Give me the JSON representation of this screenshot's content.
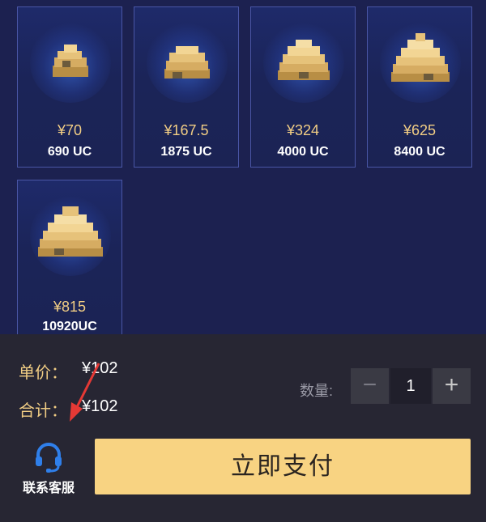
{
  "products": [
    {
      "price": "¥70",
      "amount": "690 UC"
    },
    {
      "price": "¥167.5",
      "amount": "1875 UC"
    },
    {
      "price": "¥324",
      "amount": "4000 UC"
    },
    {
      "price": "¥625",
      "amount": "8400 UC"
    },
    {
      "price": "¥815",
      "amount": "10920UC"
    }
  ],
  "summary": {
    "unit_price_label": "单价：",
    "unit_price_value": "¥102",
    "total_label": "合计：",
    "total_value": "¥102"
  },
  "quantity": {
    "label": "数量:",
    "value": "1",
    "minus": "−",
    "plus": "+"
  },
  "pay_button": "立即支付",
  "customer_service": "联系客服",
  "colors": {
    "background": "#1c2150",
    "card_border": "#4a56a6",
    "gold": "#f1cd84",
    "pay_button": "#f8d382",
    "panel": "#272633",
    "service_icon": "#2f7fea",
    "arrow": "#e53935"
  },
  "icons": {
    "product": "uc-currency-pile-icon",
    "service": "headset-icon",
    "annotation": "red-arrow-icon"
  }
}
